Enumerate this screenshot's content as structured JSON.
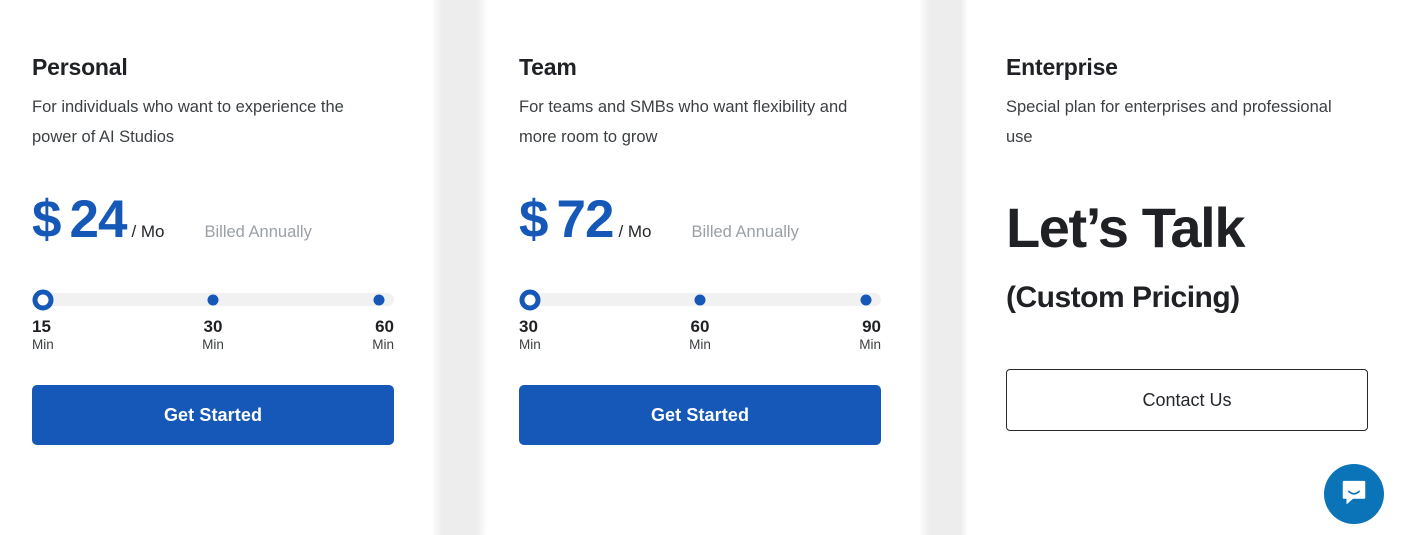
{
  "brand": {
    "blue": "#1558b8",
    "text_dark": "#1f2124",
    "muted_gray": "#9aa0a6",
    "band_gray": "#ededed",
    "intercom_blue": "#0b74b8"
  },
  "plans": [
    {
      "id": "personal",
      "name": "Personal",
      "description": "For individuals who want to experience the power of AI Studios",
      "currency": "$",
      "amount": "24",
      "per": "/ Mo",
      "billing_note": "Billed Annually",
      "slider": {
        "selected_index": 0,
        "ticks": [
          {
            "value": "15",
            "unit": "Min"
          },
          {
            "value": "30",
            "unit": "Min"
          },
          {
            "value": "60",
            "unit": "Min"
          }
        ]
      },
      "cta": "Get Started"
    },
    {
      "id": "team",
      "name": "Team",
      "description": "For teams and SMBs who want flexibility and more room to grow",
      "currency": "$",
      "amount": "72",
      "per": "/ Mo",
      "billing_note": "Billed Annually",
      "slider": {
        "selected_index": 0,
        "ticks": [
          {
            "value": "30",
            "unit": "Min"
          },
          {
            "value": "60",
            "unit": "Min"
          },
          {
            "value": "90",
            "unit": "Min"
          }
        ]
      },
      "cta": "Get Started"
    },
    {
      "id": "enterprise",
      "name": "Enterprise",
      "description": "Special plan for enterprises and professional use",
      "headline": "Let’s Talk",
      "subheadline": "(Custom Pricing)",
      "cta": "Contact Us"
    }
  ],
  "chat_widget": {
    "icon": "chat-bubble-icon",
    "label": "Open chat"
  }
}
